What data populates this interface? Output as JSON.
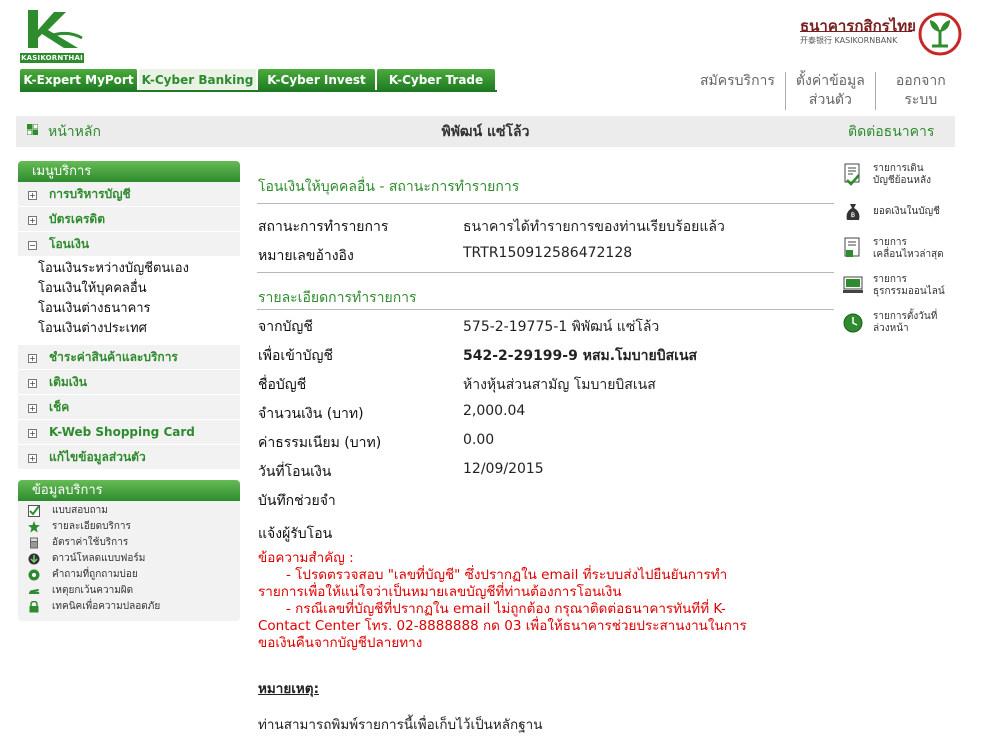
{
  "header": {
    "logo_text": "KASIKORNTHAI",
    "bank_name": "ธนาคารกสิกรไทย",
    "bank_sub": "开泰银行 KASIKORNBANK",
    "tabs": [
      {
        "label": "K-Expert MyPort",
        "active": false
      },
      {
        "label": "K-Cyber Banking",
        "active": true
      },
      {
        "label": "K-Cyber Invest",
        "active": false
      },
      {
        "label": "K-Cyber Trade",
        "active": false
      }
    ],
    "links": {
      "register": "สมัครบริการ",
      "settings_1": "ตั้งค่าข้อมูล",
      "settings_2": "ส่วนตัว",
      "logout_1": "ออกจาก",
      "logout_2": "ระบบ"
    }
  },
  "navbar": {
    "home": "หน้าหลัก",
    "user": "พิพัฒน์ แซ่โล้ว",
    "contact": "ติดต่อธนาคาร"
  },
  "sidebar": {
    "menu_title": "เมนูบริการ",
    "items": [
      {
        "label": "การบริหารบัญชี",
        "sign": "+"
      },
      {
        "label": "บัตรเครดิต",
        "sign": "+"
      },
      {
        "label": "โอนเงิน",
        "sign": "−"
      },
      {
        "label": "ชำระค่าสินค้าและบริการ",
        "sign": "+"
      },
      {
        "label": "เติมเงิน",
        "sign": "+"
      },
      {
        "label": "เช็ค",
        "sign": "+"
      },
      {
        "label": "K-Web Shopping Card",
        "sign": "+"
      },
      {
        "label": "แก้ไขข้อมูลส่วนตัว",
        "sign": "+"
      }
    ],
    "transfer_sub": [
      "โอนเงินระหว่างบัญชีตนเอง",
      "โอนเงินให้บุคคลอื่น",
      "โอนเงินต่างธนาคาร",
      "โอนเงินต่างประเทศ"
    ],
    "info_title": "ข้อมูลบริการ",
    "info_items": [
      {
        "label": "แบบสอบถาม",
        "icon": "checkmark-icon"
      },
      {
        "label": "รายละเอียดบริการ",
        "icon": "star-icon"
      },
      {
        "label": "อัตราค่าใช้บริการ",
        "icon": "calculator-icon"
      },
      {
        "label": "ดาวน์โหลดแบบฟอร์ม",
        "icon": "download-icon"
      },
      {
        "label": "คำถามที่ถูกถามบ่อย",
        "icon": "question-icon"
      },
      {
        "label": "เหตุยกเว้นความผิด",
        "icon": "hand-icon"
      },
      {
        "label": "เทคนิคเพื่อความปลอดภัย",
        "icon": "lock-icon"
      }
    ]
  },
  "main": {
    "title": "โอนเงินให้บุคคลอื่น - สถานะการทำรายการ",
    "status_label": "สถานะการทำรายการ",
    "status_value": "ธนาคารได้ทำรายการของท่านเรียบร้อยแล้ว",
    "ref_label": "หมายเลขอ้างอิง",
    "ref_value": "TRTR150912586472128",
    "details_title": "รายละเอียดการทำรายการ",
    "from_label": "จากบัญชี",
    "from_value": "575-2-19775-1 พิพัฒน์ แซ่โล้ว",
    "to_label": "เพื่อเข้าบัญชี",
    "to_value": "542-2-29199-9 หสม.โมบายบิสเนส",
    "name_label": "ชื่อบัญชี",
    "name_value": "ห้างหุ้นส่วนสามัญ โมบายบิสเนส",
    "amount_label": "จำนวนเงิน (บาท)",
    "amount_value": "2,000.04",
    "fee_label": "ค่าธรรมเนียม (บาท)",
    "fee_value": "0.00",
    "date_label": "วันที่โอนเงิน",
    "date_value": "12/09/2015",
    "memo_label": "บันทึกช่วยจำ",
    "notify_label": "แจ้งผู้รับโอน",
    "notice_title": "ข้อความสำคัญ :",
    "notice_1a": "- โปรดตรวจสอบ \"เลขที่บัญชี\" ซึ่งปรากฏใน email ที่ระบบส่งไปยืนยันการทำ",
    "notice_1b": "รายการเพื่อให้แน่ใจว่าเป็นหมายเลขบัญชีที่ท่านต้องการโอนเงิน",
    "notice_2a": "- กรณีเลขที่บัญชีที่ปรากฏใน email ไม่ถูกต้อง กรุณาติดต่อธนาคารทันทีที่ K-",
    "notice_2b": "Contact Center โทร. 02-8888888 กด 03 เพื่อให้ธนาคารช่วยประสานงานในการ",
    "notice_2c": "ขอเงินคืนจากบัญชีปลายทาง",
    "remark_title": "หมายเหตุ:",
    "remark_text": "ท่านสามารถพิมพ์รายการนี้เพื่อเก็บไว้เป็นหลักฐาน"
  },
  "right_links": [
    {
      "line1": "รายการเดิน",
      "line2": "บัญชีย้อนหลัง",
      "icon": "statement-icon"
    },
    {
      "line1": "ยอดเงินในบัญชี",
      "line2": "",
      "icon": "money-bag-icon"
    },
    {
      "line1": "รายการ",
      "line2": "เคลื่อนไหวล่าสุด",
      "icon": "recent-transactions-icon"
    },
    {
      "line1": "รายการ",
      "line2": "ธุรกรรมออนไลน์",
      "icon": "online-transactions-icon"
    },
    {
      "line1": "รายการตั้งวันที่",
      "line2": "ล่วงหน้า",
      "icon": "clock-icon"
    }
  ],
  "colors": {
    "brand_green": "#2e8b2e",
    "notice_red": "#e00000",
    "bank_maroon": "#7a1f1f"
  }
}
